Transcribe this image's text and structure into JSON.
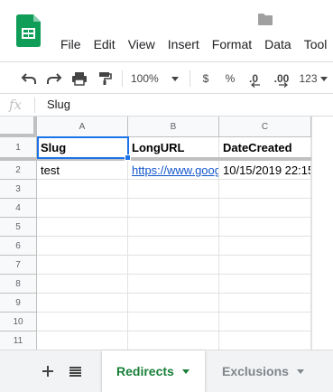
{
  "app": {
    "menu": [
      "File",
      "Edit",
      "View",
      "Insert",
      "Format",
      "Data",
      "Tool"
    ],
    "brand_color": "#0f9d58"
  },
  "toolbar": {
    "zoom": "100%",
    "currency": "$",
    "percent": "%",
    "decrease_decimal": ".0",
    "increase_decimal": ".00",
    "more_formats": "123"
  },
  "formula_bar": {
    "fx_label": "fx",
    "value": "Slug"
  },
  "grid": {
    "columns": [
      "A",
      "B",
      "C"
    ],
    "rows": [
      "1",
      "2",
      "3",
      "4",
      "5",
      "6",
      "7",
      "8",
      "9",
      "10",
      "11"
    ],
    "header_row": [
      "Slug",
      "LongURL",
      "DateCreated"
    ],
    "data_row": [
      "test",
      "https://www.goog",
      "10/15/2019 22:15"
    ],
    "selected_cell": "A1"
  },
  "sheets": {
    "tabs": [
      {
        "label": "Redirects",
        "active": true
      },
      {
        "label": "Exclusions",
        "active": false
      }
    ],
    "active_color": "#188038"
  }
}
